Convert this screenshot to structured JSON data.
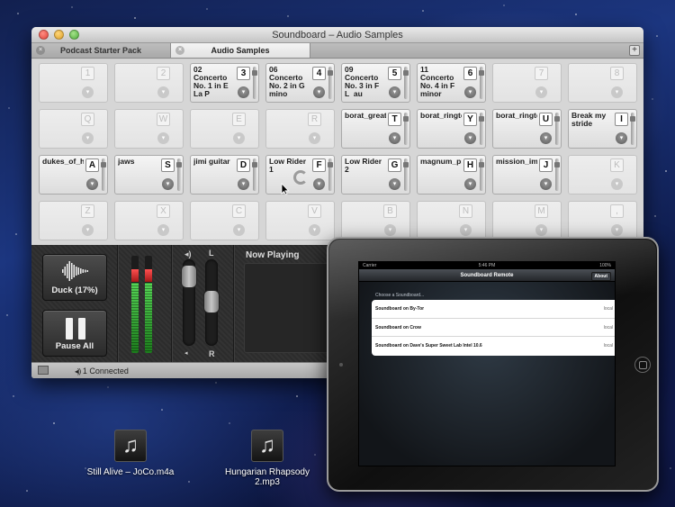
{
  "window": {
    "title": "Soundboard – Audio Samples",
    "tabs": [
      {
        "label": "Podcast Starter Pack",
        "active": false
      },
      {
        "label": "Audio Samples",
        "active": true
      }
    ],
    "add_tab": "+"
  },
  "grid": {
    "rows": [
      [
        {
          "key": "1",
          "name": ""
        },
        {
          "key": "2",
          "name": ""
        },
        {
          "key": "3",
          "name": "02 Concerto No. 1 in E La P"
        },
        {
          "key": "4",
          "name": "06 Concerto No. 2 in G mino"
        },
        {
          "key": "5",
          "name": "09 Concerto No. 3 in F L_au"
        },
        {
          "key": "6",
          "name": "11 Concerto No. 4 in F minor"
        },
        {
          "key": "7",
          "name": ""
        },
        {
          "key": "8",
          "name": ""
        }
      ],
      [
        {
          "key": "Q",
          "name": ""
        },
        {
          "key": "W",
          "name": ""
        },
        {
          "key": "E",
          "name": ""
        },
        {
          "key": "R",
          "name": ""
        },
        {
          "key": "T",
          "name": "borat_great_at_success"
        },
        {
          "key": "Y",
          "name": "borat_ringtone"
        },
        {
          "key": "U",
          "name": "borat_ringtone"
        },
        {
          "key": "I",
          "name": "Break my stride"
        }
      ],
      [
        {
          "key": "A",
          "name": "dukes_of_hazzard"
        },
        {
          "key": "S",
          "name": "jaws"
        },
        {
          "key": "D",
          "name": "jimi guitar"
        },
        {
          "key": "F",
          "name": "Low Rider 1",
          "loading": true
        },
        {
          "key": "G",
          "name": "Low Rider 2"
        },
        {
          "key": "H",
          "name": "magnum_pi"
        },
        {
          "key": "J",
          "name": "mission_impossible"
        },
        {
          "key": "K",
          "name": ""
        }
      ],
      [
        {
          "key": "Z",
          "name": ""
        },
        {
          "key": "X",
          "name": ""
        },
        {
          "key": "C",
          "name": ""
        },
        {
          "key": "V",
          "name": ""
        },
        {
          "key": "B",
          "name": ""
        },
        {
          "key": "N",
          "name": ""
        },
        {
          "key": "M",
          "name": ""
        },
        {
          "key": ",",
          "name": ""
        }
      ]
    ]
  },
  "controls": {
    "duck_label": "Duck (17%)",
    "pause_label": "Pause All",
    "left_label": "L",
    "right_label": "R",
    "now_playing": "Now Playing",
    "meter_levels": [
      0.86,
      0.86
    ]
  },
  "status": {
    "connected": "1 Connected"
  },
  "ipad": {
    "carrier": "Carrier",
    "time": "5:46 PM",
    "battery": "100%",
    "nav_title": "Soundboard Remote",
    "about": "About",
    "choose": "Choose a Soundboard...",
    "rows": [
      {
        "name": "Soundboard on By-Tor",
        "loc": "local"
      },
      {
        "name": "Soundboard on Crow",
        "loc": "local"
      },
      {
        "name": "Soundboard on Dave's Super Sweet Lab Intel 10.6",
        "loc": "local"
      }
    ]
  },
  "desktop": {
    "icons": [
      {
        "label": "Still Alive – JoCo.m4a"
      },
      {
        "label": "Hungarian Rhapsody 2.mp3"
      }
    ]
  }
}
